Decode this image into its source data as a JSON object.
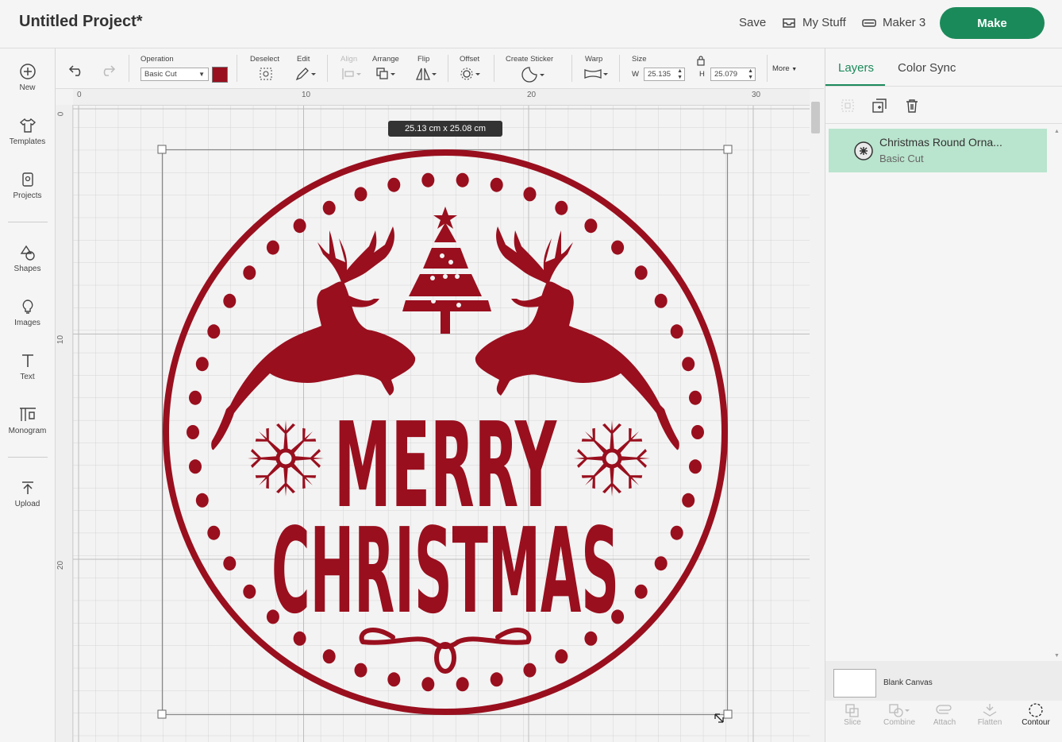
{
  "header": {
    "title": "Untitled Project*",
    "save": "Save",
    "my_stuff": "My Stuff",
    "machine": "Maker 3",
    "make": "Make"
  },
  "sidebar": {
    "items": [
      {
        "label": "New",
        "icon": "plus-circle-icon"
      },
      {
        "label": "Templates",
        "icon": "shirt-icon"
      },
      {
        "label": "Projects",
        "icon": "projects-icon"
      },
      {
        "label": "Shapes",
        "icon": "shapes-icon"
      },
      {
        "label": "Images",
        "icon": "lightbulb-icon"
      },
      {
        "label": "Text",
        "icon": "text-icon"
      },
      {
        "label": "Monogram",
        "icon": "monogram-icon"
      },
      {
        "label": "Upload",
        "icon": "upload-icon"
      }
    ]
  },
  "toolbar": {
    "operation_label": "Operation",
    "operation_value": "Basic Cut",
    "color": "#990f1e",
    "deselect": "Deselect",
    "edit": "Edit",
    "align": "Align",
    "arrange": "Arrange",
    "flip": "Flip",
    "offset": "Offset",
    "create_sticker": "Create Sticker",
    "warp": "Warp",
    "size": "Size",
    "w_label": "W",
    "w_value": "25.135",
    "h_label": "H",
    "h_value": "25.079",
    "more": "More"
  },
  "canvas": {
    "size_tooltip": "25.13  cm x 25.08  cm",
    "ruler_top": [
      "0",
      "10",
      "20",
      "30"
    ],
    "ruler_left": [
      "0",
      "10",
      "20"
    ],
    "design": {
      "line1": "MERRY",
      "line2": "CHRISTMAS",
      "color": "#990f1e"
    }
  },
  "layers_panel": {
    "tabs": [
      "Layers",
      "Color Sync"
    ],
    "layer": {
      "name": "Christmas Round Orna...",
      "operation": "Basic Cut"
    },
    "blank_canvas": "Blank Canvas",
    "bottom_tools": [
      "Slice",
      "Combine",
      "Attach",
      "Flatten",
      "Contour"
    ]
  }
}
